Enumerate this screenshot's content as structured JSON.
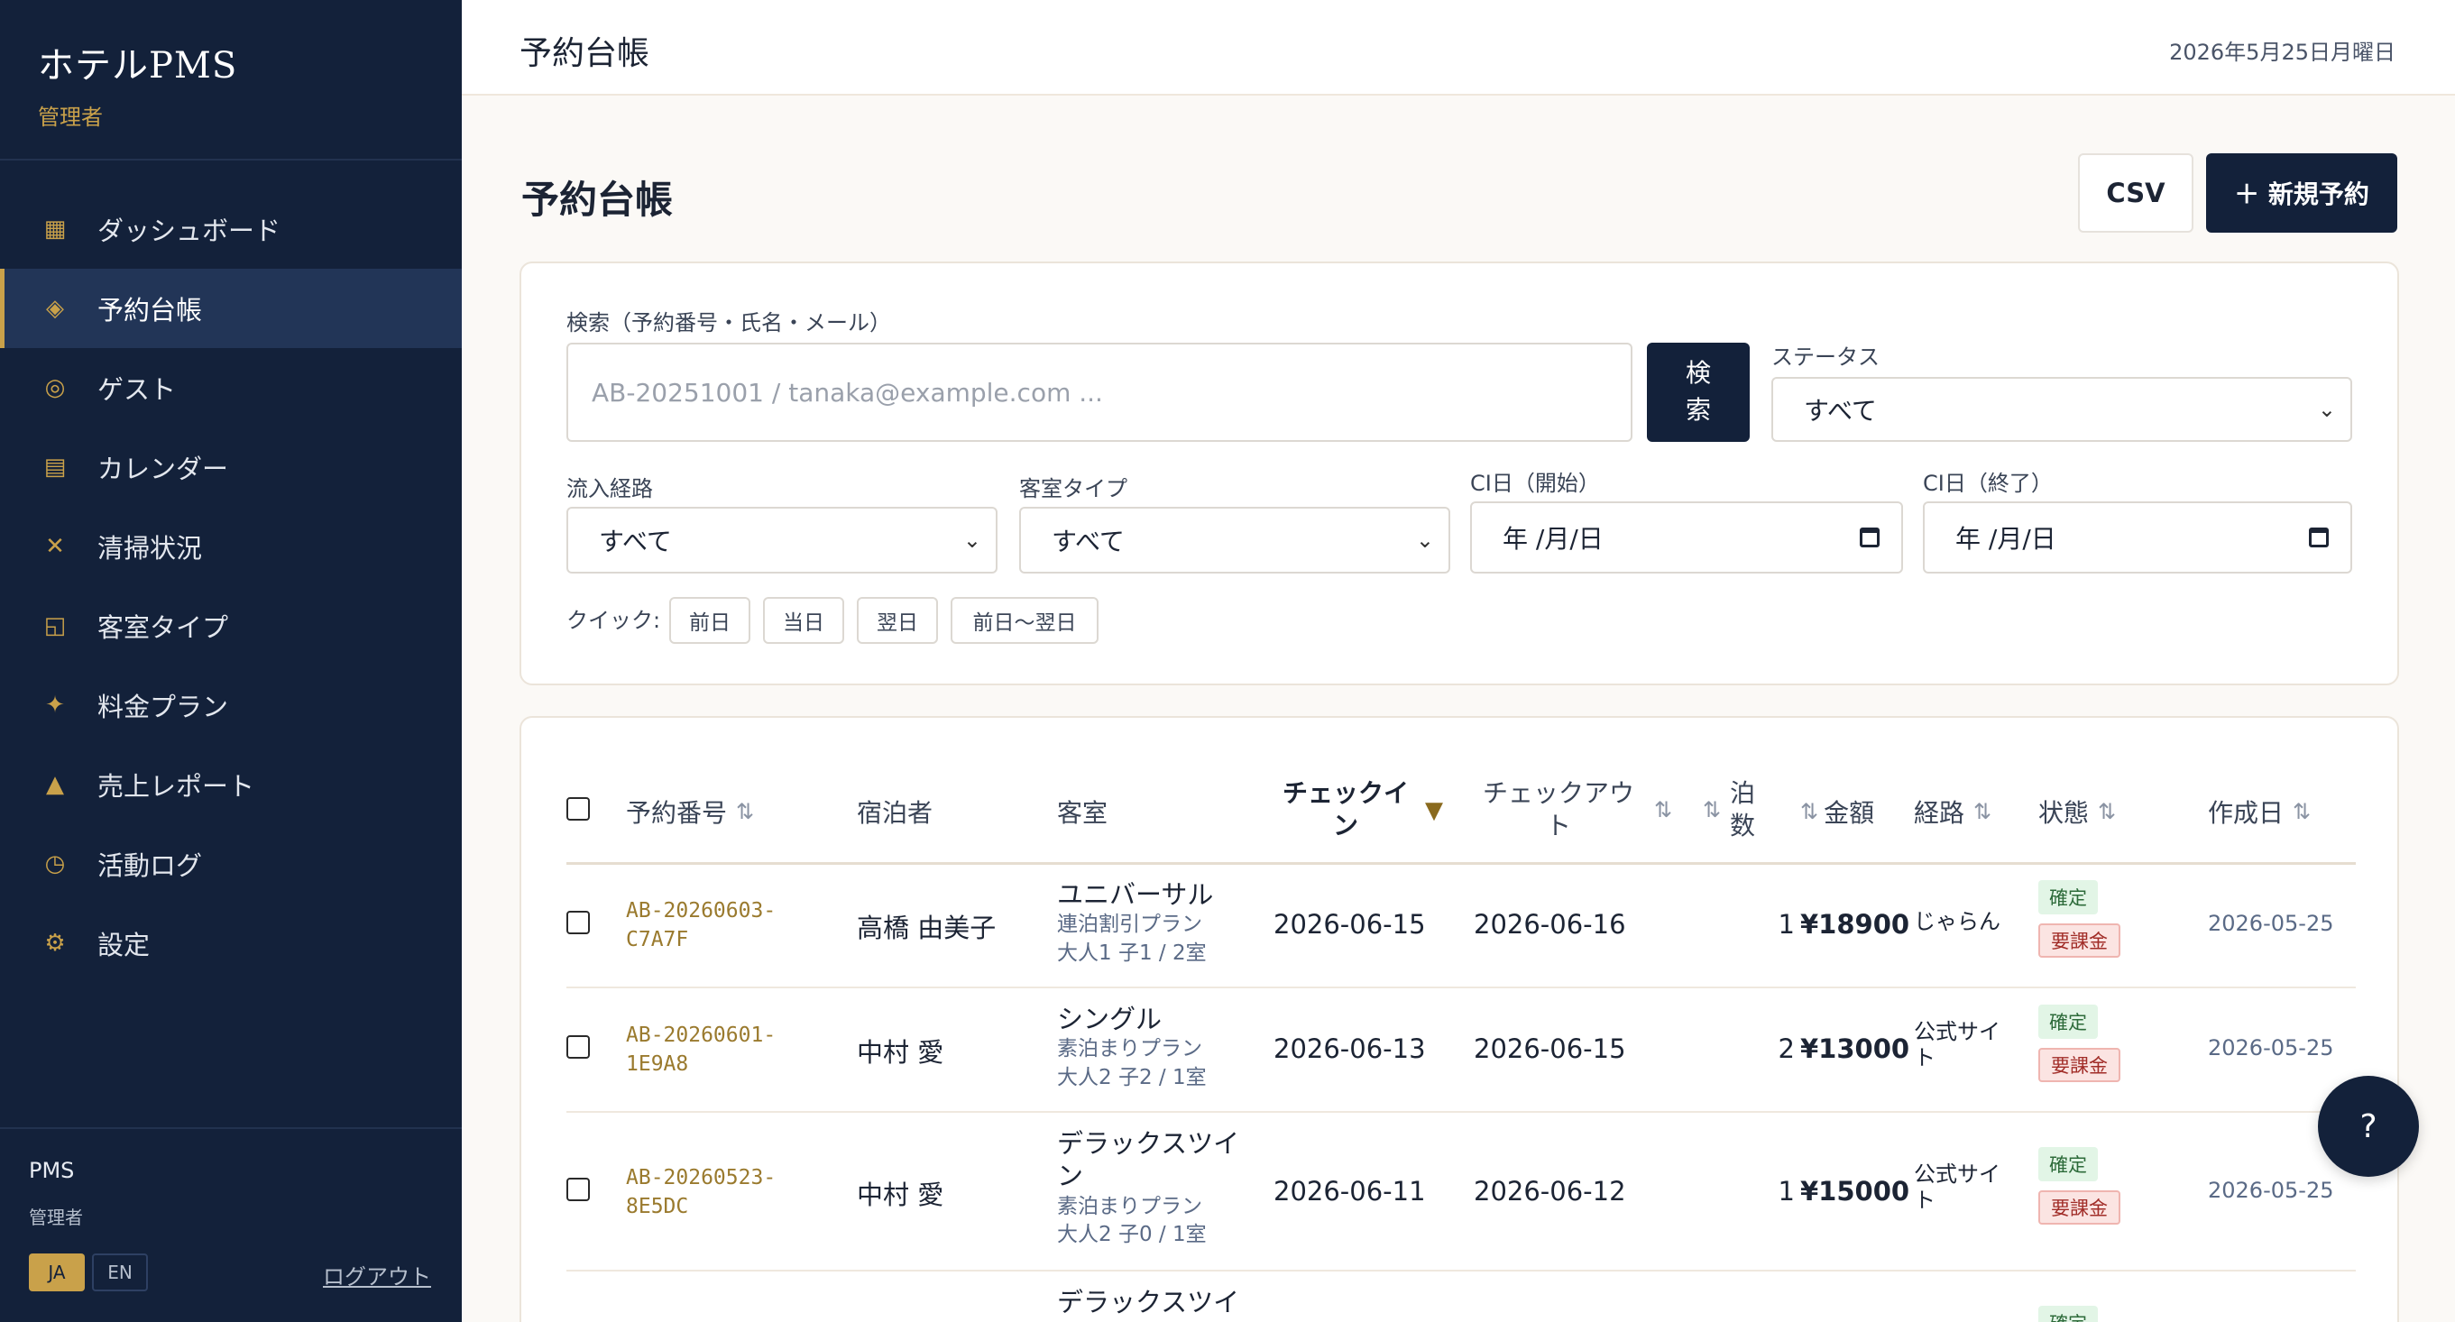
{
  "sidebar": {
    "brand": "ホテルPMS",
    "brand_sub": "管理者",
    "items": [
      {
        "label": "ダッシュボード",
        "icon": "grid-icon"
      },
      {
        "label": "予約台帳",
        "icon": "diamond-icon"
      },
      {
        "label": "ゲスト",
        "icon": "circle-icon"
      },
      {
        "label": "カレンダー",
        "icon": "calendar-icon"
      },
      {
        "label": "清掃状況",
        "icon": "cross-icon"
      },
      {
        "label": "客室タイプ",
        "icon": "room-icon"
      },
      {
        "label": "料金プラン",
        "icon": "star-icon"
      },
      {
        "label": "売上レポート",
        "icon": "triangle-icon"
      },
      {
        "label": "活動ログ",
        "icon": "clock-icon"
      },
      {
        "label": "設定",
        "icon": "gear-icon"
      }
    ],
    "footer": {
      "app": "PMS",
      "role": "管理者",
      "lang_ja": "JA",
      "lang_en": "EN",
      "logout": "ログアウト"
    }
  },
  "topbar": {
    "title": "予約台帳",
    "date": "2026年5月25日月曜日"
  },
  "page": {
    "title": "予約台帳",
    "csv_label": "CSV",
    "new_label": "＋ 新規予約"
  },
  "filters": {
    "search_label": "検索（予約番号・氏名・メール）",
    "search_placeholder": "AB-20251001 / tanaka@example.com ...",
    "search_button_line1": "検",
    "search_button_line2": "索",
    "status_label": "ステータス",
    "status_value": "すべて",
    "channel_label": "流入経路",
    "channel_value": "すべて",
    "roomtype_label": "客室タイプ",
    "roomtype_value": "すべて",
    "ci_start_label": "CI日（開始）",
    "ci_start_value": "年 /月/日",
    "ci_end_label": "CI日（終了）",
    "ci_end_value": "年 /月/日",
    "quick_label": "クイック:",
    "quick": [
      "前日",
      "当日",
      "翌日",
      "前日〜翌日"
    ]
  },
  "table": {
    "headers": {
      "id": "予約番号",
      "guest": "宿泊者",
      "room": "客室",
      "checkin_1": "チェックイ",
      "checkin_2": "ン",
      "checkout_1": "チェックアウ",
      "checkout_2": "ト",
      "nights_1": "泊",
      "nights_2": "数",
      "amount": "金額",
      "route": "経路",
      "status": "状態",
      "created": "作成日",
      "sort_glyph": "⇅",
      "sort_active_glyph": "▼"
    },
    "rows": [
      {
        "id1": "AB-20260603-",
        "id2": "C7A7F",
        "guest": "高橋 由美子",
        "room": "ユニバーサル",
        "room2": "",
        "plan": "連泊割引プラン",
        "pax": "大人1 子1 / 2室",
        "checkin": "2026-06-15",
        "checkout": "2026-06-16",
        "nights": "1",
        "amount": "¥18900",
        "route1": "じゃらん",
        "route2": "",
        "status": "確定",
        "pay": "要課金",
        "created": "2026-05-25"
      },
      {
        "id1": "AB-20260601-",
        "id2": "1E9A8",
        "guest": "中村 愛",
        "room": "シングル",
        "room2": "",
        "plan": "素泊まりプラン",
        "pax": "大人2 子2 / 1室",
        "checkin": "2026-06-13",
        "checkout": "2026-06-15",
        "nights": "2",
        "amount": "¥13000",
        "route1": "公式サイ",
        "route2": "ト",
        "status": "確定",
        "pay": "要課金",
        "created": "2026-05-25"
      },
      {
        "id1": "AB-20260523-",
        "id2": "8E5DC",
        "guest": "中村 愛",
        "room": "デラックスツイ",
        "room2": "ン",
        "plan": "素泊まりプラン",
        "pax": "大人2 子0 / 1室",
        "checkin": "2026-06-11",
        "checkout": "2026-06-12",
        "nights": "1",
        "amount": "¥15000",
        "route1": "公式サイ",
        "route2": "ト",
        "status": "確定",
        "pay": "要課金",
        "created": "2026-05-25"
      },
      {
        "room": "デラックスツイ",
        "status": "確定"
      }
    ]
  },
  "help_label": "?",
  "colors": {
    "navy": "#13213a",
    "gold": "#c9a14a",
    "ok_bg": "#e2f5e6",
    "pay_bg": "#fbe4e2"
  }
}
